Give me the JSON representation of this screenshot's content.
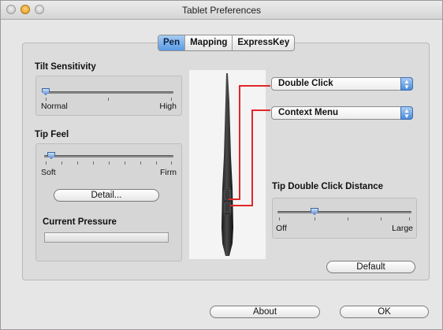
{
  "window": {
    "title": "Tablet Preferences"
  },
  "tabs": [
    {
      "label": "Pen",
      "active": true
    },
    {
      "label": "Mapping",
      "active": false
    },
    {
      "label": "ExpressKey",
      "active": false
    }
  ],
  "tilt": {
    "label": "Tilt Sensitivity",
    "min_label": "Normal",
    "max_label": "High",
    "value": 0.0
  },
  "tipfeel": {
    "label": "Tip Feel",
    "min_label": "Soft",
    "max_label": "Firm",
    "value": 0.05,
    "detail_button": "Detail..."
  },
  "pressure": {
    "label": "Current Pressure",
    "value": 0.0
  },
  "upper_button_menu": {
    "selected": "Double Click"
  },
  "lower_button_menu": {
    "selected": "Context Menu"
  },
  "double_click_distance": {
    "label": "Tip Double Click Distance",
    "min_label": "Off",
    "max_label": "Large",
    "value": 0.3
  },
  "buttons": {
    "default": "Default",
    "about": "About",
    "ok": "OK"
  },
  "colors": {
    "connector": "#e1262a",
    "accent": "#5a9ae4"
  }
}
